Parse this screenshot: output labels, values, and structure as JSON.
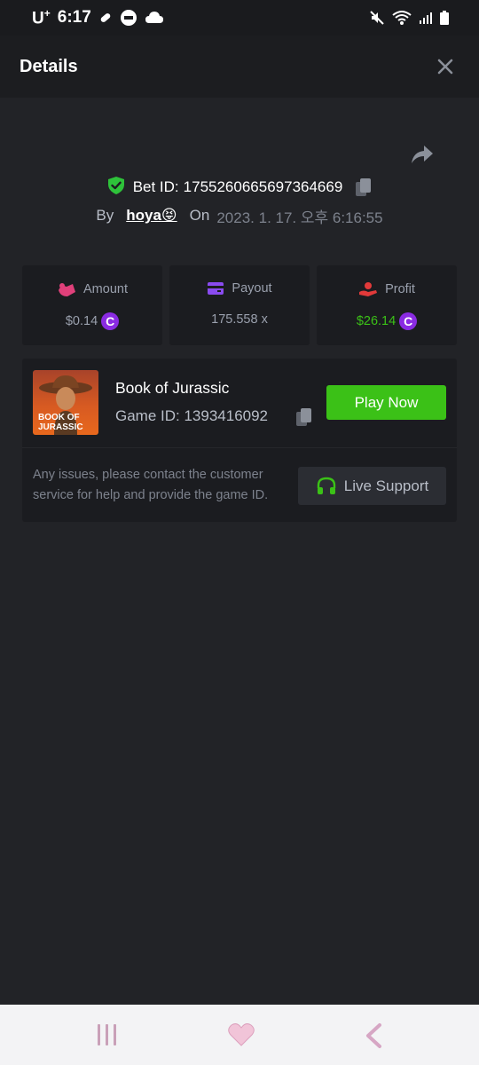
{
  "status_bar": {
    "carrier": "U",
    "carrier_sup": "+",
    "time": "6:17"
  },
  "header": {
    "title": "Details"
  },
  "bet": {
    "label": "Bet ID:",
    "id": "1755260665697364669",
    "by_label": "By",
    "user": "hoya",
    "user_emoji": "😝",
    "on_label": "On",
    "date": "2023. 1. 17. 오후 6:16:55"
  },
  "stats": {
    "amount": {
      "label": "Amount",
      "value": "$0.14",
      "coin": "C"
    },
    "payout": {
      "label": "Payout",
      "value": "175.558 x"
    },
    "profit": {
      "label": "Profit",
      "value": "$26.14",
      "coin": "C"
    }
  },
  "game": {
    "thumb_line1": "BOOK OF",
    "thumb_line2": "JURASSIC",
    "name": "Book of Jurassic",
    "id_label": "Game ID: 1393416092",
    "play_label": "Play Now",
    "help_text": "Any issues, please contact the customer service for help and provide the game ID.",
    "support_label": "Live Support"
  },
  "colors": {
    "background": "#222327",
    "panel": "#1b1c20",
    "accent_green": "#3bc117",
    "coin_purple": "#8a2be2",
    "profit_green": "#3bc117",
    "shield_green": "#2ec23a"
  },
  "icons": [
    "shield-check-icon",
    "copy-icon",
    "share-icon",
    "close-icon",
    "amount-icon",
    "payout-card-icon",
    "profit-hand-icon",
    "headset-icon",
    "recent-apps-icon",
    "home-icon",
    "back-icon"
  ]
}
